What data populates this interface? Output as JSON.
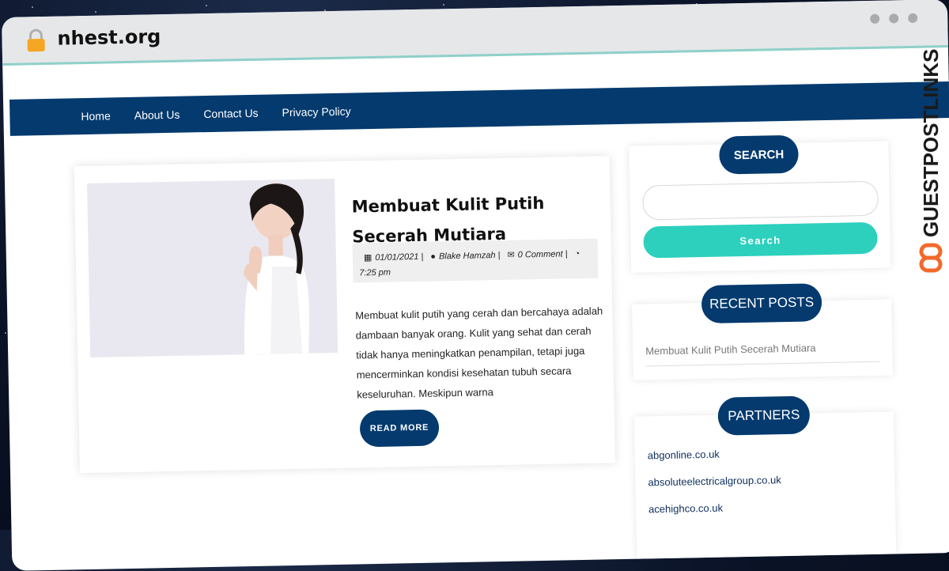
{
  "browser": {
    "url": "nhest.org"
  },
  "nav": {
    "items": [
      "Home",
      "About Us",
      "Contact Us",
      "Privacy Policy"
    ]
  },
  "post": {
    "title": "Membuat Kulit Putih Secerah Mutiara",
    "date": "01/01/2021",
    "author": "Blake Hamzah",
    "comments": "0 Comment",
    "time": "7:25 pm",
    "excerpt": "Membuat kulit putih yang cerah dan bercahaya adalah dambaan banyak orang. Kulit yang sehat dan cerah tidak hanya meningkatkan penampilan, tetapi juga mencerminkan kondisi kesehatan tubuh secara keseluruhan. Meskipun warna",
    "read_more": "READ MORE"
  },
  "sidebar": {
    "search": {
      "heading": "SEARCH",
      "button": "Search"
    },
    "recent": {
      "heading": "RECENT POSTS",
      "items": [
        "Membuat Kulit Putih Secerah Mutiara"
      ]
    },
    "partners": {
      "heading": "PARTNERS",
      "items": [
        "abgonline.co.uk",
        "absoluteelectricalgroup.co.uk",
        "acehighco.co.uk"
      ]
    }
  },
  "watermark": {
    "text": "GUESTPOSTLINKS"
  },
  "colors": {
    "primary": "#043a6e",
    "accent": "#2dd0bd"
  }
}
